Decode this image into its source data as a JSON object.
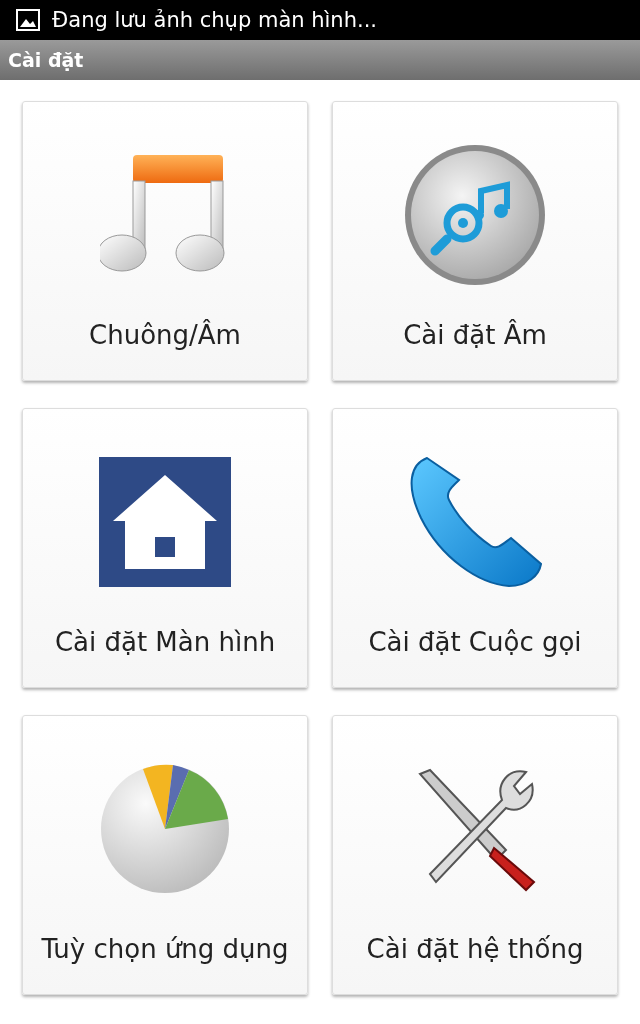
{
  "status_bar": {
    "notification": "Đang lưu ảnh chụp màn hình..."
  },
  "title_bar": {
    "title": "Cài đặt"
  },
  "tiles": [
    {
      "label": "Chuông/Âm"
    },
    {
      "label": "Cài đặt Âm"
    },
    {
      "label": "Cài đặt Màn hình"
    },
    {
      "label": "Cài đặt Cuộc gọi"
    },
    {
      "label": "Tuỳ chọn ứng dụng"
    },
    {
      "label": "Cài đặt hệ thống"
    }
  ]
}
